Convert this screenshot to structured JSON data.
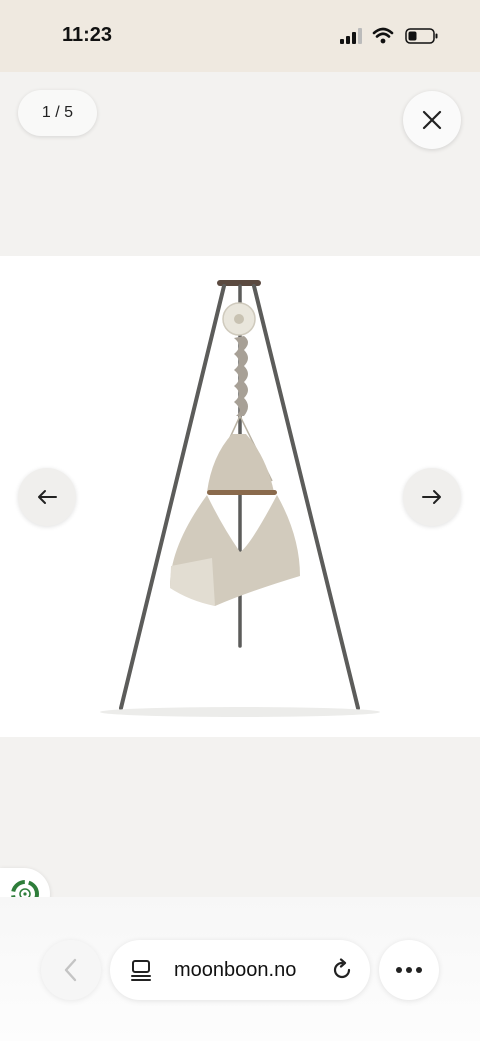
{
  "status_bar": {
    "time": "11:23"
  },
  "gallery": {
    "counter": "1 / 5",
    "close_icon": "close-icon",
    "prev_icon": "arrow-left-icon",
    "next_icon": "arrow-right-icon",
    "image": "hammock-cradle-stand"
  },
  "browser": {
    "url": "moonboon.no",
    "back_icon": "chevron-left-icon",
    "reader_icon": "reader-icon",
    "reload_icon": "reload-icon",
    "more_icon": "more-icon"
  },
  "badge": {
    "icon": "eco-recycle-icon"
  },
  "colors": {
    "status_bg": "#efe9e0",
    "gallery_bg": "#f3f2f0",
    "frame": "#5c5c5a",
    "fabric": "#d2cbbd",
    "eco_green": "#2e7d3a"
  }
}
